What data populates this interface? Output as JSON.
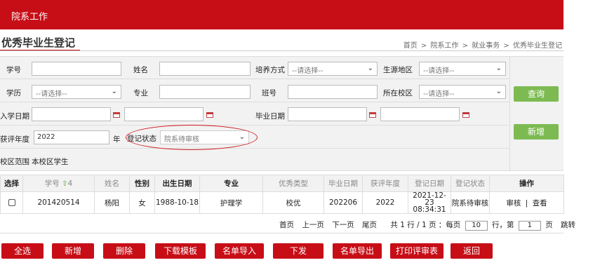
{
  "header": {
    "title": "院系工作"
  },
  "page": {
    "title": "优秀毕业生登记",
    "breadcrumb": [
      "首页",
      "院系工作",
      "就业事务",
      "优秀毕业生登记"
    ],
    "breadcrumb_sep": ">"
  },
  "form": {
    "row1": {
      "student_no_label": "学号",
      "student_no_value": "",
      "name_label": "姓名",
      "name_value": "",
      "training_label": "培养方式",
      "training_value": "--请选择--",
      "origin_label": "生源地区",
      "origin_value": "--请选择--"
    },
    "row2": {
      "education_label": "学历",
      "education_value": "--请选择--",
      "major_label": "专业",
      "major_value": "",
      "class_label": "班号",
      "class_value": "",
      "campus_label": "所在校区",
      "campus_value": "--请选择--"
    },
    "row3": {
      "enroll_label": "入学日期",
      "grad_label": "毕业日期"
    },
    "row4": {
      "year_label": "获评年度",
      "year_value": "2022",
      "year_unit": "年",
      "status_label": "登记状态",
      "status_value": "院系待审核"
    },
    "row5": {
      "scope_label": "校区范围",
      "scope_value": "本校区学生"
    },
    "query_button": "查询",
    "add_button": "新增"
  },
  "table": {
    "headers": {
      "select": "选择",
      "student_no": "学号",
      "sort_indicator": "4",
      "name": "姓名",
      "gender": "性别",
      "birth": "出生日期",
      "major": "专业",
      "type": "优秀类型",
      "grad_date": "毕业日期",
      "year": "获评年度",
      "reg_date": "登记日期",
      "status": "登记状态",
      "action": "操作"
    },
    "rows": [
      {
        "student_no": "201420514",
        "name": "杨阳",
        "gender": "女",
        "birth": "1988-10-18",
        "major": "护理学",
        "type": "校优",
        "grad_date": "202206",
        "year": "2022",
        "reg_date": "2021-12-23",
        "reg_time": "08:34:31",
        "status": "院系待审核",
        "action_review": "审核",
        "action_view": "查看",
        "action_sep": "|"
      }
    ]
  },
  "pager": {
    "first": "首页",
    "prev": "上一页",
    "next": "下一页",
    "last": "尾页",
    "summary": "共 1 行 / 1 页 ：每页",
    "page_size": "10",
    "rows_unit": "行，第",
    "page_no": "1",
    "page_unit": "页",
    "jump": "跳转"
  },
  "buttons": {
    "select_all": "全选",
    "add": "新增",
    "delete": "删除",
    "download_template": "下载模板",
    "import_list": "名单导入",
    "issue": "下发",
    "export_list": "名单导出",
    "print_table": "打印评审表",
    "back": "返回"
  },
  "colors": {
    "brand_red": "#c70e17",
    "action_green": "#7dbb52"
  },
  "icons": {
    "date_picker": "calendar-icon",
    "dropdown": "chevron-down-icon",
    "sort": "sort-up-icon"
  }
}
